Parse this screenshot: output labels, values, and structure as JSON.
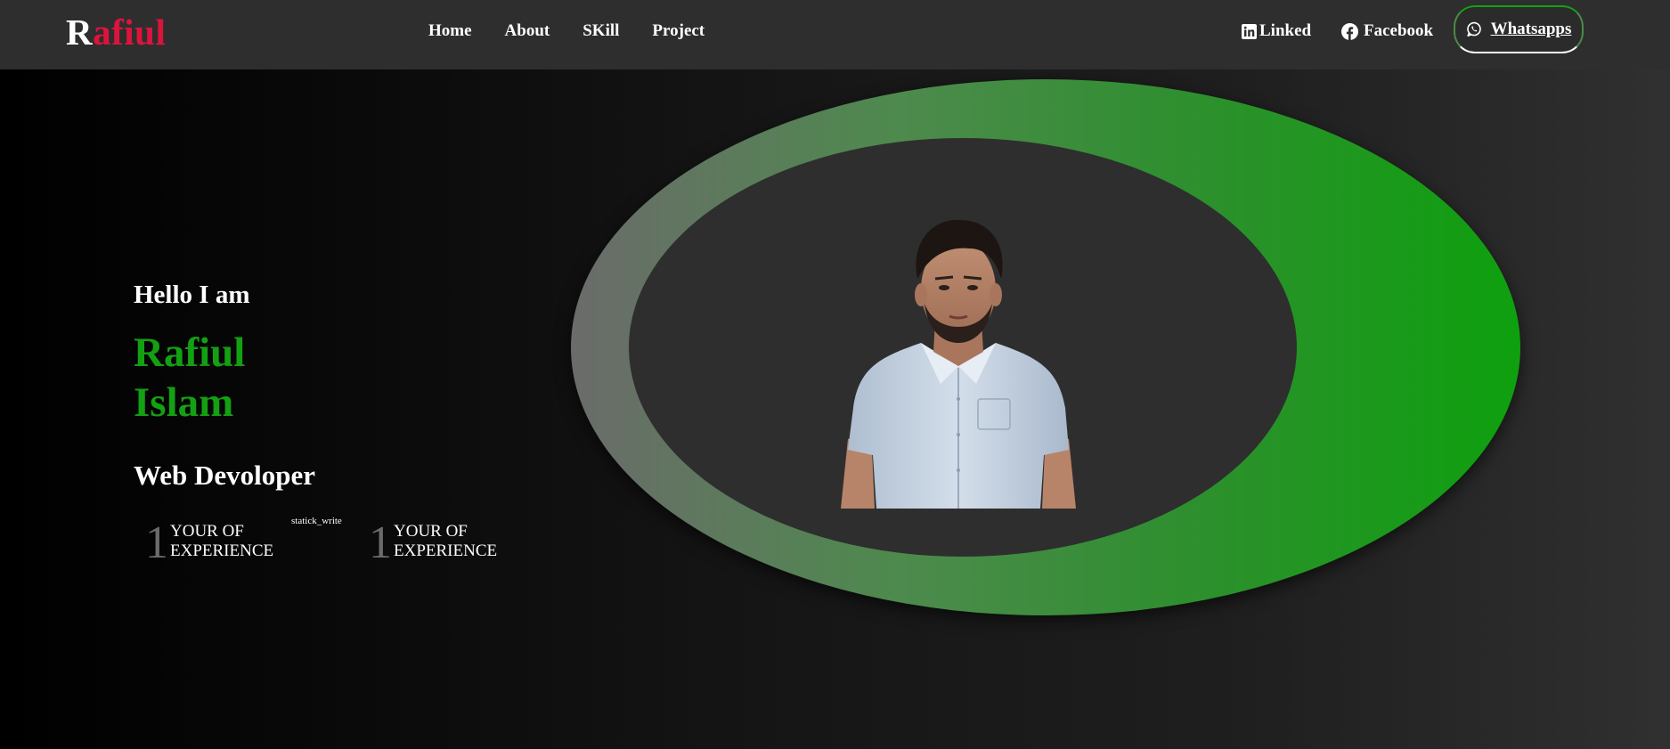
{
  "logo": {
    "first_letter": "R",
    "rest": "afiul"
  },
  "nav": {
    "home": "Home",
    "about": "About",
    "skill": "SKill",
    "project": "Project"
  },
  "social": {
    "linked": "Linked",
    "facebook": "Facebook",
    "whatsapp": "Whatsapps"
  },
  "hero": {
    "greeting": "Hello I am",
    "first_name": "Rafiul",
    "last_name": "Islam",
    "role": "Web Devoloper"
  },
  "stats": [
    {
      "number": "1",
      "label_line1": "YOUR OF",
      "label_line2": "EXPERIENCE"
    },
    {
      "number": "1",
      "label_line1": "YOUR OF",
      "label_line2": "EXPERIENCE"
    }
  ],
  "image_alt_text": "statick_write",
  "colors": {
    "accent_green": "#13a013",
    "logo_red": "#dc143c",
    "navbar_bg": "#2e2e2e"
  },
  "icons": [
    "linkedin-icon",
    "facebook-icon",
    "whatsapp-icon"
  ]
}
